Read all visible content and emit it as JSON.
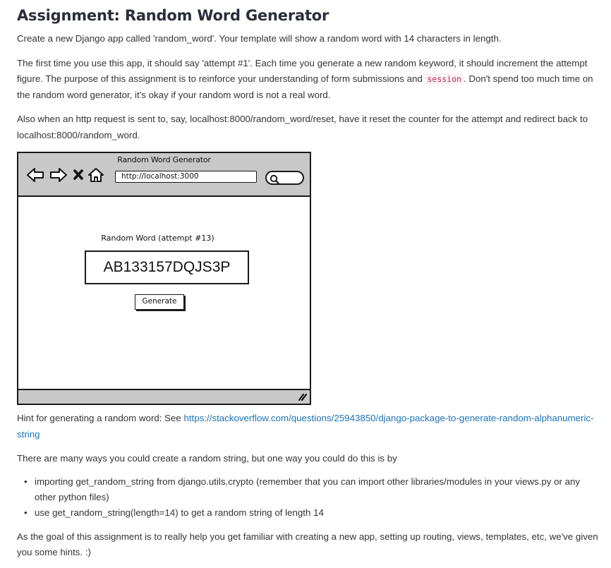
{
  "title": "Assignment: Random Word Generator",
  "intro": "Create a new Django app called 'random_word'. Your template will show a random word with 14 characters in length.",
  "attempts": {
    "text_before": "The first time you use this app, it should say 'attempt #1'. Each time you generate a new random keyword, it should increment the attempt figure. The purpose of this assignment is to reinforce your understanding of form submissions and ",
    "code": "session",
    "text_after": ". Don't spend too much time on the random word generator, it's okay if your random word is not a real word."
  },
  "reset": "Also when an http request is sent to, say, localhost:8000/random_word/reset, have it reset the counter for the attempt and redirect back to localhost:8000/random_word.",
  "mockup": {
    "window_title": "Random Word Generator",
    "url": "http://localhost:3000",
    "label": "Random Word (attempt #13)",
    "word": "AB133157DQJS3P",
    "button": "Generate",
    "icons": [
      "back-arrow-icon",
      "forward-arrow-icon",
      "close-x-icon",
      "home-icon",
      "search-icon",
      "resize-grip-icon"
    ]
  },
  "hint": {
    "text": "Hint for generating a random word: See ",
    "link": "https://stackoverflow.com/questions/25943850/django-package-to-generate-random-alphanumeric-string"
  },
  "ways": "There are many ways you could create a random string, but one way you could do this is by",
  "list": [
    "importing get_random_string from django.utils.crypto (remember that you can import other libraries/modules in your views.py or any other python files)",
    "use get_random_string(length=14) to get a random string of length 14"
  ],
  "outro": "As the goal of this assignment is to really help you get familiar with creating a new app, setting up routing, views, templates, etc, we've given you some hints. :)"
}
